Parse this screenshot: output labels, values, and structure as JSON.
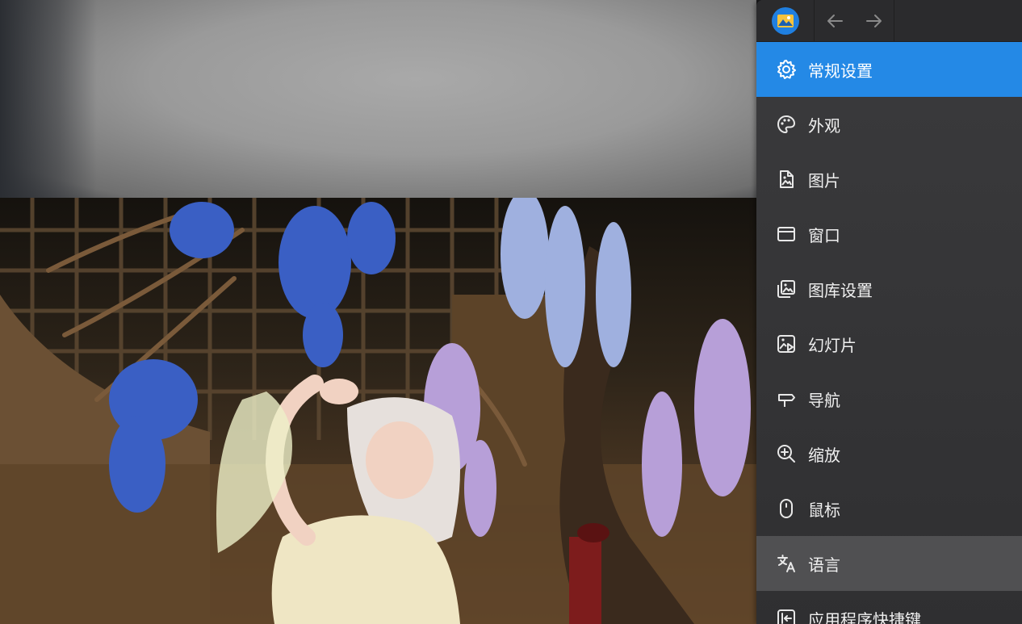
{
  "header": {
    "app_icon": "image-viewer-logo-icon",
    "back_icon": "arrow-left-icon",
    "forward_icon": "arrow-right-icon"
  },
  "sidebar": {
    "items": [
      {
        "label": "常规设置",
        "icon": "gear-icon",
        "state": "active"
      },
      {
        "label": "外观",
        "icon": "palette-icon"
      },
      {
        "label": "图片",
        "icon": "image-file-icon"
      },
      {
        "label": "窗口",
        "icon": "window-icon"
      },
      {
        "label": "图库设置",
        "icon": "gallery-icon"
      },
      {
        "label": "幻灯片",
        "icon": "slideshow-icon"
      },
      {
        "label": "导航",
        "icon": "signpost-icon"
      },
      {
        "label": "缩放",
        "icon": "zoom-in-icon"
      },
      {
        "label": "鼠标",
        "icon": "mouse-icon"
      },
      {
        "label": "语言",
        "icon": "translate-icon",
        "state": "hover"
      },
      {
        "label": "应用程序快捷键",
        "icon": "keyboard-shortcut-icon"
      }
    ]
  },
  "colors": {
    "accent": "#2489e6",
    "sidebar_bg": "#3b3b3d",
    "hover_bg": "#505052",
    "text": "#f0f0f0"
  }
}
